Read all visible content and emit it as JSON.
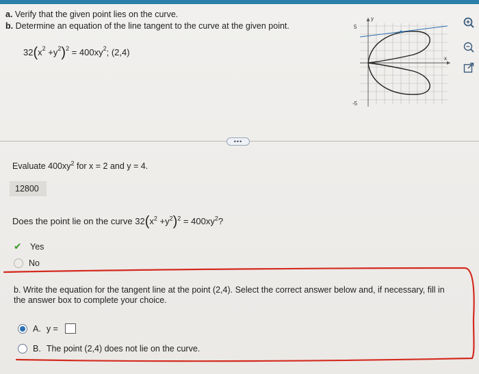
{
  "question": {
    "part_a_marker": "a.",
    "part_a_text": "Verify that the given point lies on the curve.",
    "part_b_marker": "b.",
    "part_b_text": "Determine an equation of the line tangent to the curve at the given point.",
    "equation": {
      "coef": "32",
      "x": "x",
      "y": "y",
      "plus": "+",
      "exp": "2",
      "rhs": "= 400xy",
      "point": "; (2,4)"
    }
  },
  "graph": {
    "y_label": "y",
    "x_label": "x",
    "y_top_tick": "5",
    "y_bottom_tick": "-5"
  },
  "icons": {
    "zoom_in": "zoom-in-icon",
    "zoom_out": "zoom-out-icon",
    "popout": "external-link-icon"
  },
  "more_button_label": "•••",
  "step1": {
    "prompt_prefix": "Evaluate 400xy",
    "prompt_exp": "2",
    "prompt_suffix": " for x = 2 and y = 4.",
    "answer": "12800"
  },
  "step2": {
    "prompt_prefix": "Does the point lie on the curve 32",
    "prompt_rhs": "= 400xy",
    "prompt_end": "?",
    "options": [
      {
        "label": "Yes",
        "selected": true
      },
      {
        "label": "No",
        "selected": false
      }
    ]
  },
  "part_b": {
    "text_line1": "b. Write the equation for the tangent line at the point (2,4). Select the correct answer below and, if necessary, fill in",
    "text_line2": "the answer box to complete your choice.",
    "option_a_letter": "A.",
    "option_a_text": "y =",
    "option_b_letter": "B.",
    "option_b_text": "The point (2,4) does not lie on the curve."
  },
  "colors": {
    "accent": "#2b7fa8",
    "annotation_red": "#d42a1e",
    "check_green": "#3a9a2a",
    "radio_blue": "#2c6fb3"
  }
}
